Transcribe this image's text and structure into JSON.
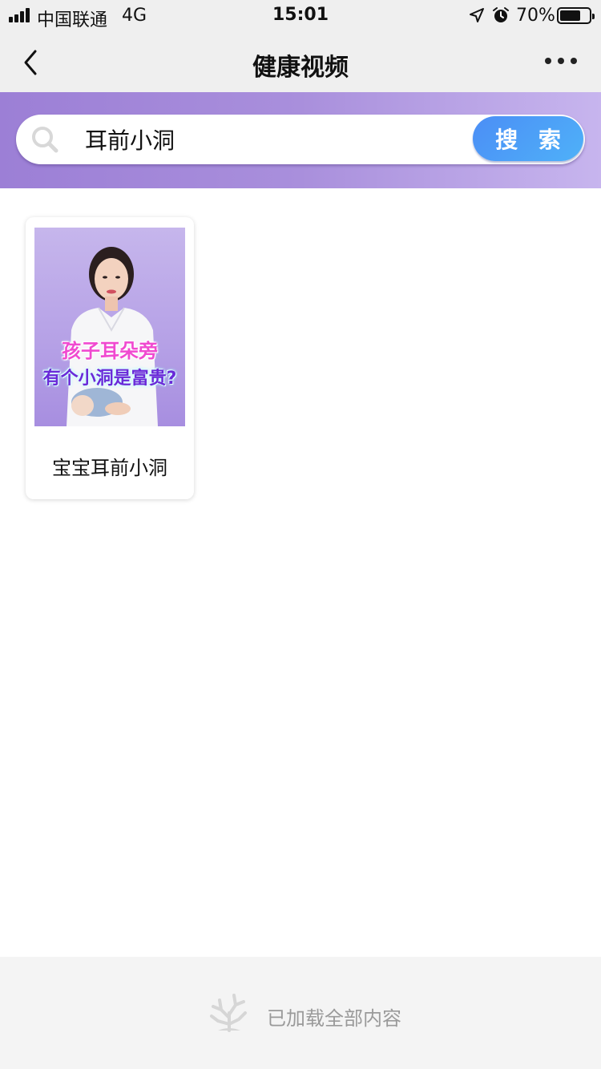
{
  "status_bar": {
    "carrier": "中国联通",
    "network": "4G",
    "time": "15:01",
    "battery_text": "70%",
    "battery_level": 0.7,
    "icons": [
      "signal-icon",
      "location-icon",
      "alarm-icon",
      "battery-icon"
    ]
  },
  "nav": {
    "title": "健康视频",
    "back_icon": "chevron-left-icon",
    "more_icon": "more-dots-icon"
  },
  "search": {
    "value": "耳前小洞",
    "button_label": "搜 索",
    "icon": "search-icon"
  },
  "results": [
    {
      "title": "宝宝耳前小洞",
      "thumbnail_caption_line1": "孩子耳朵旁",
      "thumbnail_caption_line2": "有个小洞是富贵?"
    }
  ],
  "footer": {
    "text": "已加载全部内容",
    "icon": "coral-icon"
  },
  "colors": {
    "band_gradient_start": "#9c7fd6",
    "band_gradient_end": "#c7b5ee",
    "search_button": "#4b9ef7",
    "caption_pink": "#f04ad0",
    "caption_purple": "#6a2ad8"
  }
}
